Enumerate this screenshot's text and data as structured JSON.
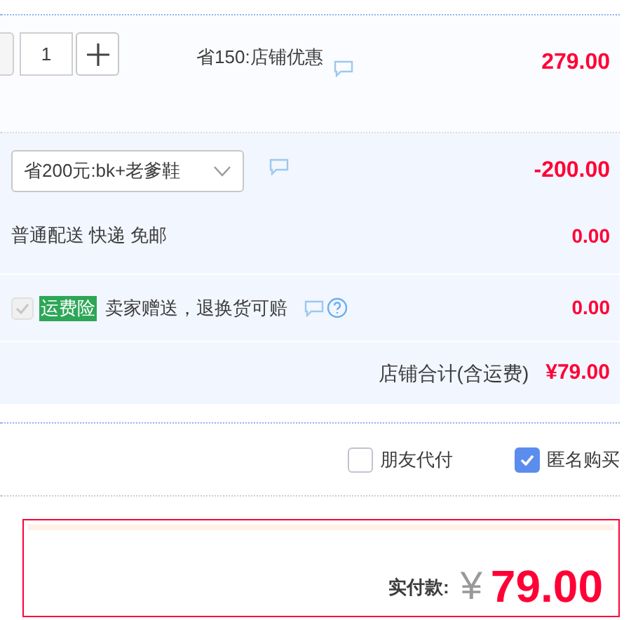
{
  "item": {
    "quantity": "1",
    "promo": "省150:店铺优惠",
    "price": "279.00"
  },
  "shop_discount": {
    "selected_option": "省200元:bk+老爹鞋",
    "amount": "-200.00"
  },
  "shipping": {
    "method": "普通配送 快递 免邮",
    "amount": "0.00"
  },
  "insurance": {
    "checked": true,
    "disabled": true,
    "tag": "运费险",
    "text": "卖家赠送，退换货可赔",
    "amount": "0.00"
  },
  "shop_total": {
    "label": "店铺合计(含运费)",
    "amount": "¥79.00"
  },
  "options": [
    {
      "label": "朋友代付",
      "checked": false
    },
    {
      "label": "匿名购买",
      "checked": true
    }
  ],
  "payment": {
    "label": "实付款:",
    "currency": "¥",
    "amount": "79.00"
  }
}
